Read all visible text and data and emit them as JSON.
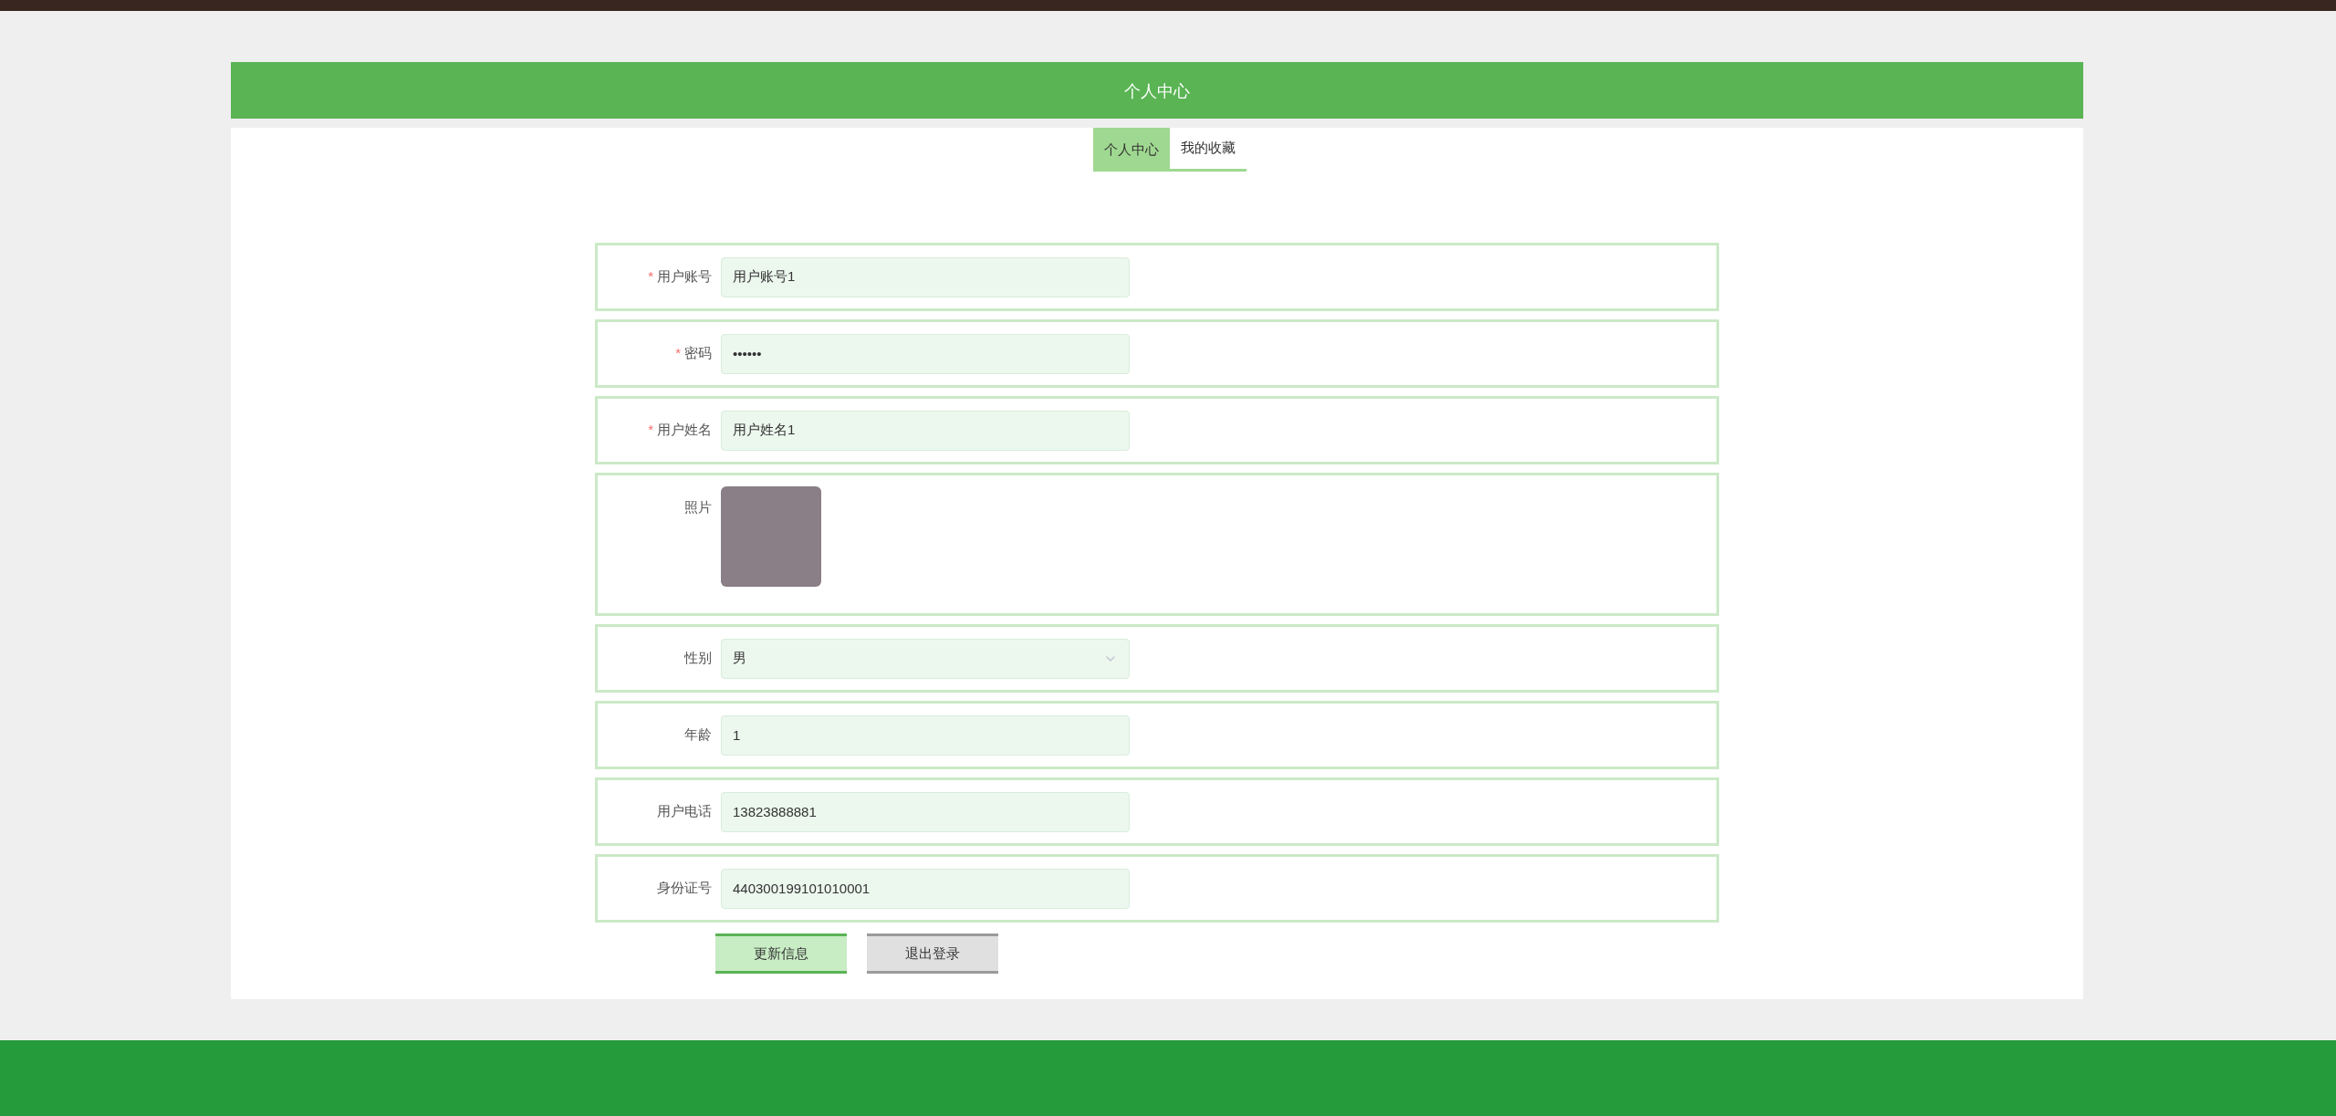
{
  "header": {
    "title": "个人中心"
  },
  "tabs": [
    {
      "label": "个人中心",
      "selected": true
    },
    {
      "label": "我的收藏",
      "selected": false
    }
  ],
  "form": {
    "fields": [
      {
        "kind": "text",
        "label": "用户账号",
        "required_mark": "*",
        "value": "用户账号1"
      },
      {
        "kind": "password",
        "label": "密码",
        "required_mark": "*",
        "value": "••••••"
      },
      {
        "kind": "text",
        "label": "用户姓名",
        "required_mark": "*",
        "value": "用户姓名1"
      },
      {
        "kind": "image",
        "label": "照片"
      },
      {
        "kind": "select",
        "label": "性别",
        "value": "男"
      },
      {
        "kind": "text",
        "label": "年龄",
        "value": "1"
      },
      {
        "kind": "text",
        "label": "用户电话",
        "value": "13823888881"
      },
      {
        "kind": "text",
        "label": "身份证号",
        "value": "440300199101010001"
      }
    ],
    "buttons": [
      {
        "label": "更新信息",
        "kind": "primary"
      },
      {
        "label": "退出登录",
        "kind": "secondary"
      }
    ]
  }
}
